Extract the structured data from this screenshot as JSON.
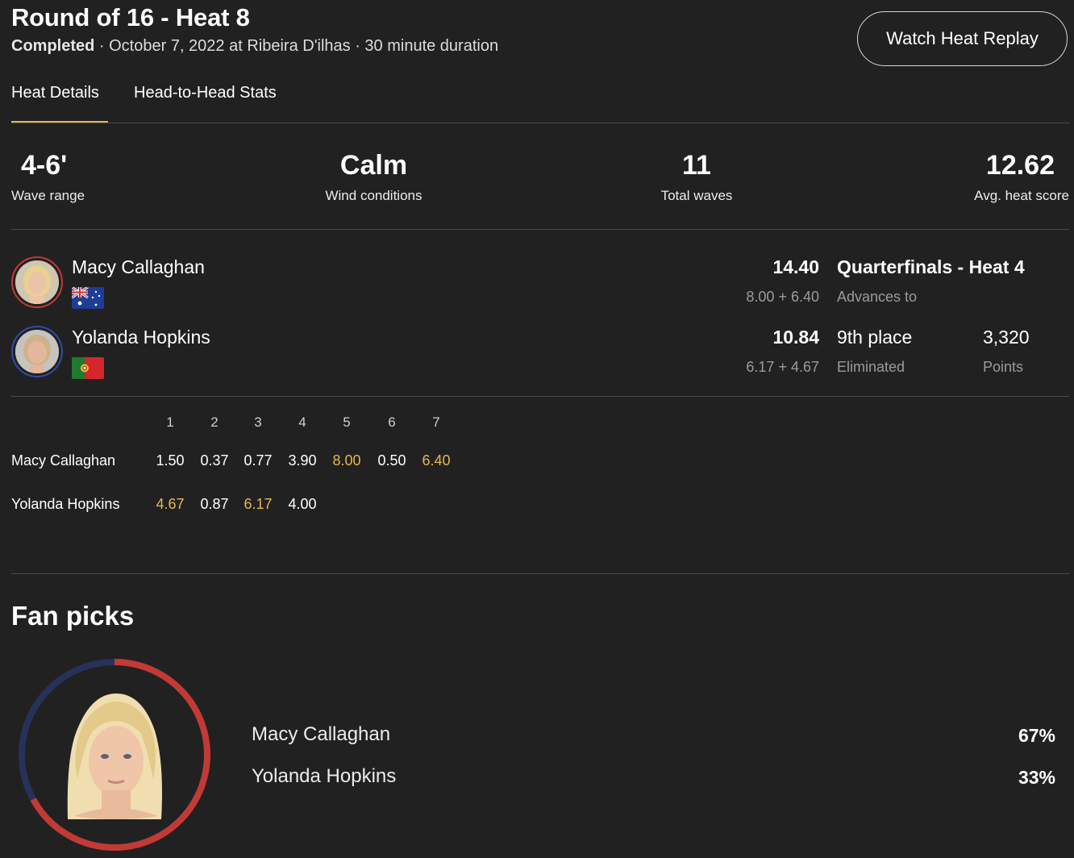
{
  "header": {
    "title": "Round of 16 - Heat 8",
    "status": "Completed",
    "details": " · October 7, 2022 at Ribeira D'ilhas · 30 minute duration",
    "replay_button": "Watch Heat Replay"
  },
  "tabs": [
    {
      "label": "Heat Details",
      "active": true
    },
    {
      "label": "Head-to-Head Stats",
      "active": false
    }
  ],
  "stats": [
    {
      "value": "4-6'",
      "label": "Wave range"
    },
    {
      "value": "Calm",
      "label": "Wind conditions"
    },
    {
      "value": "11",
      "label": "Total waves"
    },
    {
      "value": "12.62",
      "label": "Avg. heat score"
    }
  ],
  "athletes": [
    {
      "name": "Macy Callaghan",
      "country_flag": "australia-flag",
      "ring_color": "#c23a35",
      "total": "14.40",
      "breakdown": "8.00 + 6.40",
      "result": "Quarterfinals - Heat 4",
      "result_label": "Advances to"
    },
    {
      "name": "Yolanda Hopkins",
      "country_flag": "portugal-flag",
      "ring_color": "#2c4ea8",
      "total": "10.84",
      "breakdown": "6.17 + 4.67",
      "result": "9th place",
      "result_label": "Eliminated",
      "points": "3,320",
      "points_label": "Points"
    }
  ],
  "waves": {
    "headers": [
      "1",
      "2",
      "3",
      "4",
      "5",
      "6",
      "7"
    ],
    "rows": [
      {
        "name": "Macy Callaghan",
        "scores": [
          "1.50",
          "0.37",
          "0.77",
          "3.90",
          "8.00",
          "0.50",
          "6.40"
        ],
        "counted": [
          4,
          6
        ]
      },
      {
        "name": "Yolanda Hopkins",
        "scores": [
          "4.67",
          "0.87",
          "6.17",
          "4.00"
        ],
        "counted": [
          0,
          2
        ]
      }
    ]
  },
  "fan_picks": {
    "title": "Fan picks",
    "entries": [
      {
        "name": "Macy Callaghan",
        "pct": "67%",
        "value": 0.67,
        "color": "#c23a35"
      },
      {
        "name": "Yolanda Hopkins",
        "pct": "33%",
        "value": 0.33,
        "color": "#27325a"
      }
    ]
  },
  "colors": {
    "background": "#212121",
    "accent": "#e6b74f",
    "divider": "#4a4a4a"
  }
}
